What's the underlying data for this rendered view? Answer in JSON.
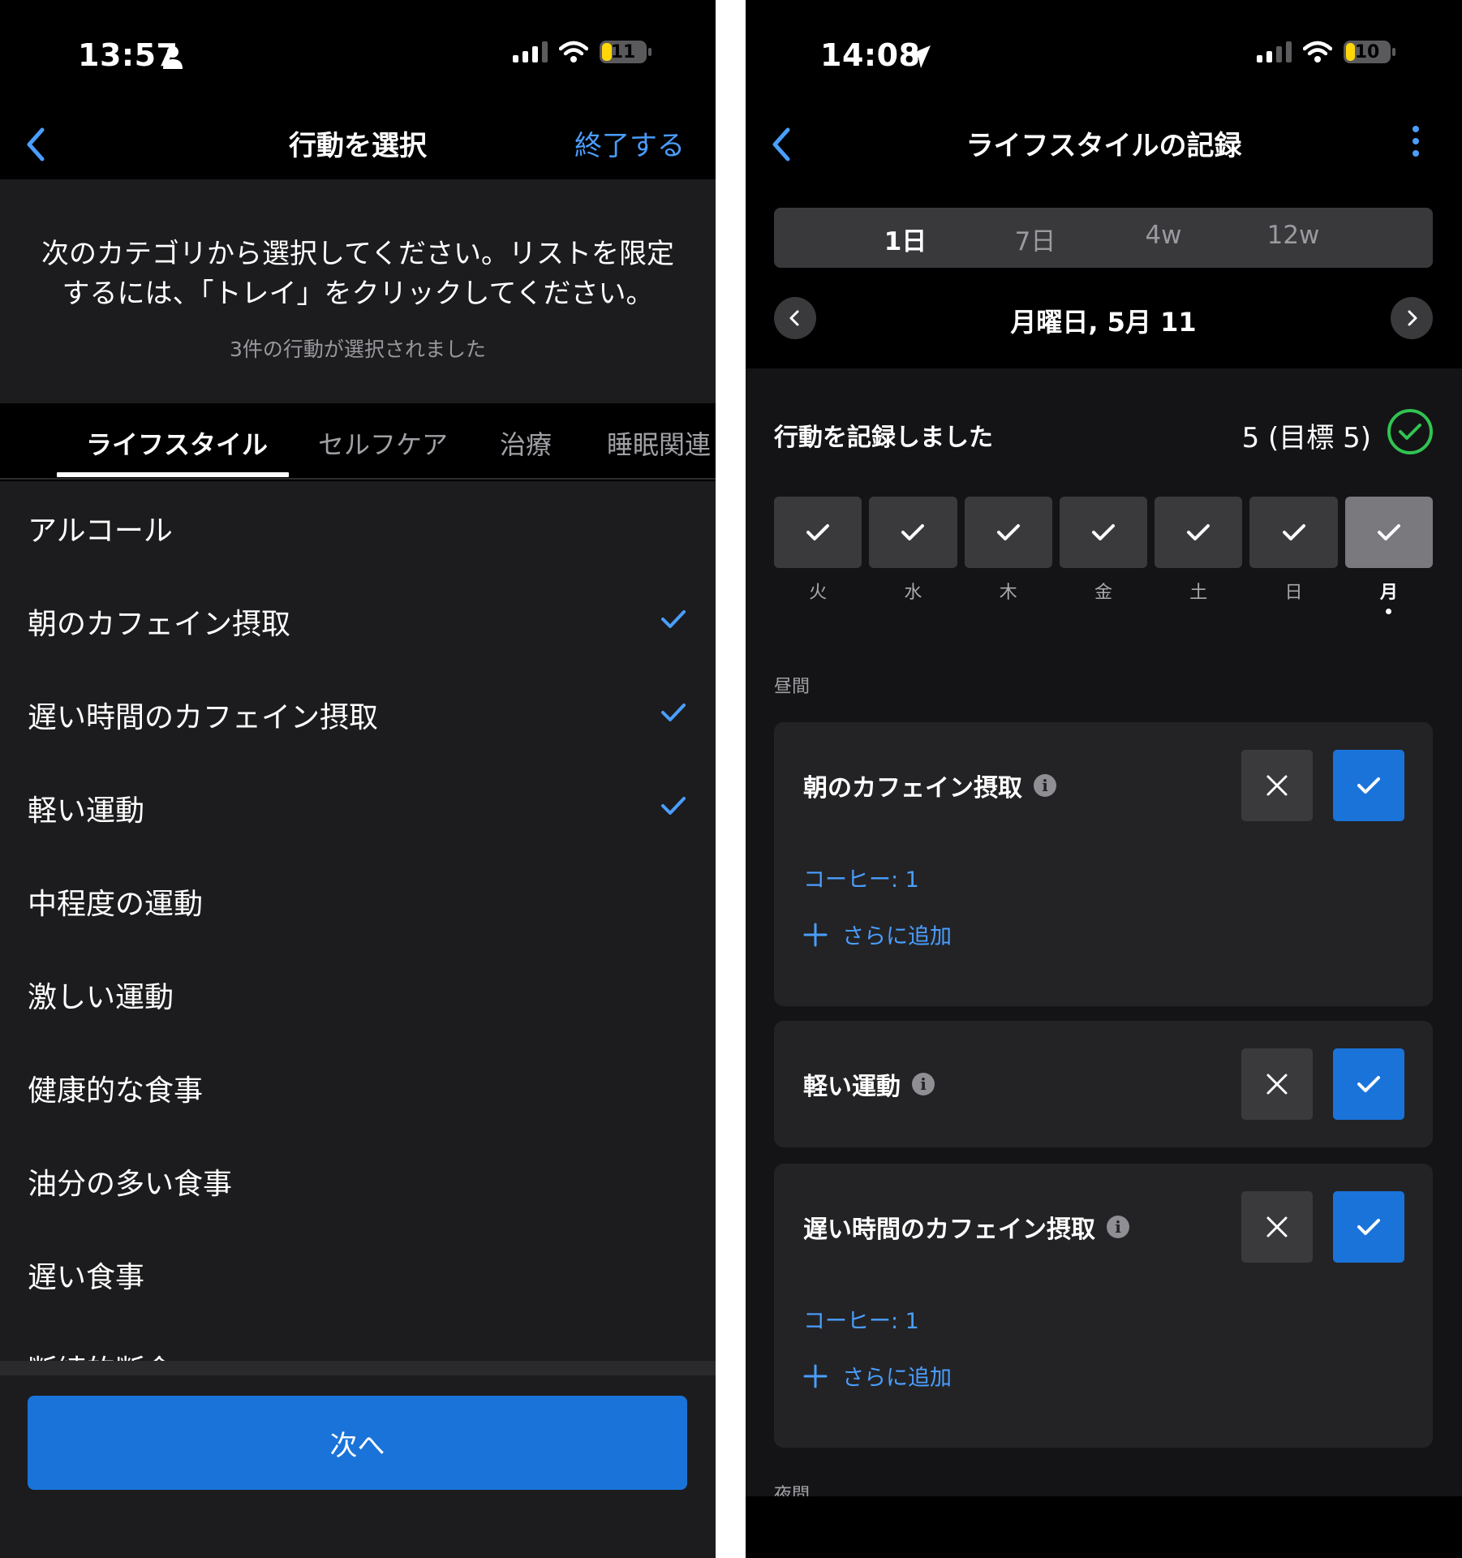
{
  "left": {
    "status": {
      "time": "13:57",
      "person_icon": "person-icon",
      "battery": "11"
    },
    "nav": {
      "title": "行動を選択",
      "finish": "終了する"
    },
    "instructions": "次のカテゴリから選択してください。リストを限定するには、「トレイ」をクリックしてください。",
    "instructions_line1": "次のカテゴリから選択してください。リストを限定",
    "instructions_line2": "するには、「トレイ」をクリックしてください。",
    "selected_count": "3件の行動が選択されました",
    "tabs": [
      {
        "label": "ライフスタイル",
        "active": true
      },
      {
        "label": "セルフケア",
        "active": false
      },
      {
        "label": "治療",
        "active": false
      },
      {
        "label": "睡眠関連",
        "active": false
      }
    ],
    "items": [
      {
        "label": "アルコール",
        "checked": false
      },
      {
        "label": "朝のカフェイン摂取",
        "checked": true
      },
      {
        "label": "遅い時間のカフェイン摂取",
        "checked": true
      },
      {
        "label": "軽い運動",
        "checked": true
      },
      {
        "label": "中程度の運動",
        "checked": false
      },
      {
        "label": "激しい運動",
        "checked": false
      },
      {
        "label": "健康的な食事",
        "checked": false
      },
      {
        "label": "油分の多い食事",
        "checked": false
      },
      {
        "label": "遅い食事",
        "checked": false
      },
      {
        "label": "断続的断食",
        "checked": false
      }
    ],
    "next_button": "次へ"
  },
  "right": {
    "status": {
      "time": "14:08",
      "location_icon": "location-arrow-icon",
      "battery": "10"
    },
    "nav": {
      "title": "ライフスタイルの記録"
    },
    "segments": [
      {
        "label": "1日",
        "active": true
      },
      {
        "label": "7日",
        "active": false
      },
      {
        "label": "4w",
        "active": false
      },
      {
        "label": "12w",
        "active": false
      }
    ],
    "date": "月曜日, 5月 11",
    "summary": {
      "label": "行動を記録しました",
      "value": "5 (目標 5)"
    },
    "days": [
      {
        "label": "火",
        "today": false
      },
      {
        "label": "水",
        "today": false
      },
      {
        "label": "木",
        "today": false
      },
      {
        "label": "金",
        "today": false
      },
      {
        "label": "土",
        "today": false
      },
      {
        "label": "日",
        "today": false
      },
      {
        "label": "月",
        "today": true
      }
    ],
    "section_day": "昼間",
    "section_night": "夜間",
    "cards": [
      {
        "title": "朝のカフェイン摂取",
        "detail": "コーヒー: 1",
        "add_more": "さらに追加"
      },
      {
        "title": "軽い運動"
      },
      {
        "title": "遅い時間のカフェイン摂取",
        "detail": "コーヒー: 1",
        "add_more": "さらに追加"
      }
    ]
  },
  "colors": {
    "accent": "#1a73d9",
    "link": "#4a9eff",
    "success": "#30c452",
    "battery": "#ffd60a"
  }
}
